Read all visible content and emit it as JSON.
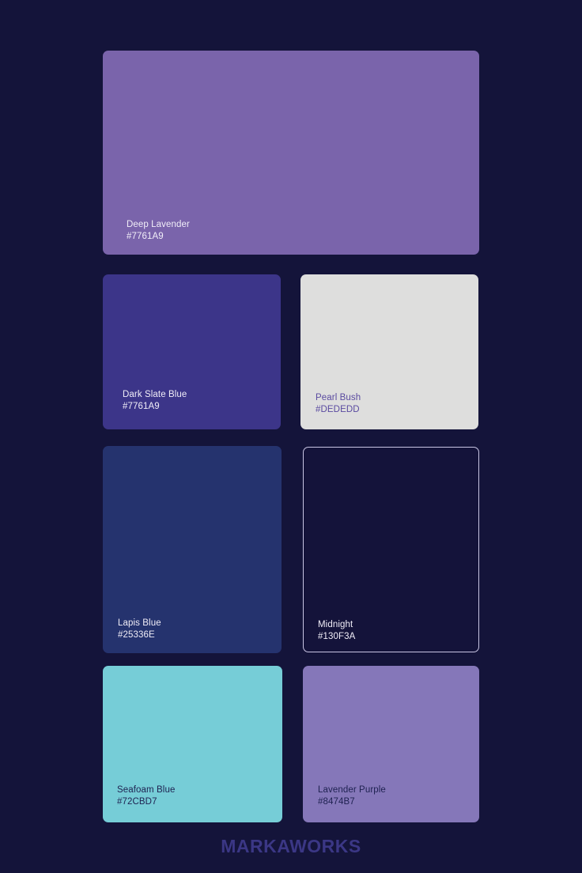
{
  "palette": {
    "background": "#14143A",
    "swatches": [
      {
        "name": "Deep Lavender",
        "hex": "#7761A9",
        "fill": "#7A64AB"
      },
      {
        "name": "Dark Slate Blue",
        "hex": "#7761A9",
        "fill": "#3C3589"
      },
      {
        "name": "Pearl Bush",
        "hex": "#DEDEDD",
        "fill": "#DEDEDD"
      },
      {
        "name": "Lapis Blue",
        "hex": "#25336E",
        "fill": "#25336E"
      },
      {
        "name": "Midnight",
        "hex": "#130F3A",
        "fill": "#14133A"
      },
      {
        "name": "Seafoam Blue",
        "hex": "#72CBD7",
        "fill": "#76CDD7"
      },
      {
        "name": "Lavender Purple",
        "hex": "#8474B7",
        "fill": "#8577B9"
      }
    ]
  },
  "brand": {
    "logo_text": "MARKAWORKS"
  }
}
